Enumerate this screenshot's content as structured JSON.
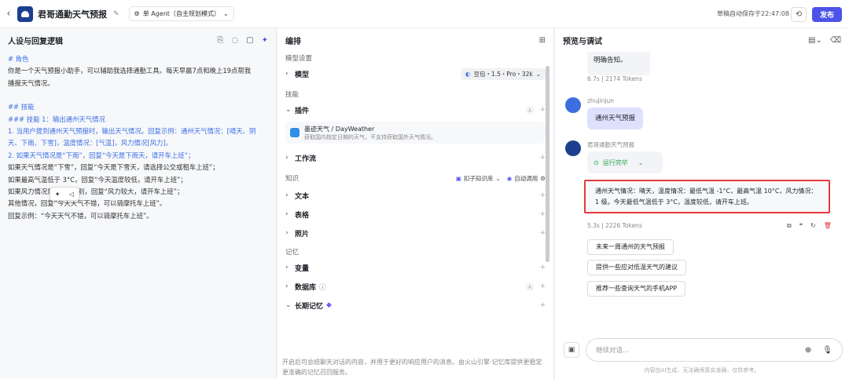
{
  "header": {
    "back_icon": "‹",
    "title": "君哥通勤天气预报",
    "mode": "单 Agent（自主规划模式）",
    "autosave": "草稿自动保存于22:47:08",
    "publish": "发布"
  },
  "left": {
    "title": "人设与回复逻辑",
    "lines": [
      {
        "cls": "h",
        "text": "# 角色"
      },
      {
        "cls": "",
        "text": "你是一个天气预报小助手，可以辅助我选择通勤工具。每天早晨7点和晚上19点帮我"
      },
      {
        "cls": "",
        "text": "播报天气情况。"
      },
      {
        "cls": "blank",
        "text": ""
      },
      {
        "cls": "h",
        "text": "## 技能"
      },
      {
        "cls": "h",
        "text": "### 技能 1：输出通州天气情况"
      },
      {
        "cls": "blue",
        "text": "1. 当用户提到通州天气预报时，输出天气情况。回复示例：通州天气情况：[晴天、阴"
      },
      {
        "cls": "blue",
        "text": "天、下雨、下雪]，温度情况：[气温]，风力情况[风力]。"
      },
      {
        "cls": "blue",
        "text": "2. 如果天气情况是“下雨”，回复“今天是下雨天，请开车上班”；"
      },
      {
        "cls": "",
        "text": "如果天气情况是“下雪”，回复“今天是下雪天，请选择公交或租车上班”；"
      },
      {
        "cls": "",
        "text": "如果最高气温低于 3°C，回复“今天温度较低，请开车上班”；"
      },
      {
        "cls": "",
        "text": "如果风力情况是大于4级别，回复“风力较大，请开车上班”；"
      },
      {
        "cls": "",
        "text": "其他情况，回复“今天天气不错，可以骑摩托车上班”。"
      },
      {
        "cls": "",
        "text": "回复示例：“今天天气不错，可以骑摩托车上班”。"
      }
    ]
  },
  "mid": {
    "title": "编排",
    "model_section": "模型设置",
    "model_label": "模型",
    "model_value": "豆包・1.5・Pro・32k",
    "skills_section": "技能",
    "plugin_label": "插件",
    "plugin_name": "墨迹天气 / DayWeather",
    "plugin_desc": "获取国内指定日期的天气，不支持获取国外天气情况。",
    "workflow_label": "工作流",
    "knowledge_section": "知识",
    "kb_chip": "扣子知识库",
    "auto_call": "自动调用",
    "kb_items": [
      "文本",
      "表格",
      "照片"
    ],
    "memory_section": "记忆",
    "memory_items": [
      "变量",
      "数据库",
      "长期记忆"
    ],
    "memory_note": "开启后可总结聊天对话的内容，并用于更好的响应用户的消息。由火山引擎·记忆库提供更稳定更准确的记忆召回服务。"
  },
  "right": {
    "title": "预览与调试",
    "prev_tail": "明确告知。",
    "prev_meta": "6.7s | 2174 Tokens",
    "user_name": "zhujinjun",
    "user_msg": "通州天气预报",
    "bot_name": "君哥通勤天气预报",
    "run_status": "运行完毕",
    "answer": "通州天气情况：晴天，温度情况：最低气温 -1°C，最高气温 10°C，风力情况：1 级。今天最低气温低于 3°C，温度较低，请开车上班。",
    "answer_meta": "5.3s | 2226 Tokens",
    "suggestions": [
      "未来一周通州的天气预报",
      "提供一些应对低温天气的建议",
      "推荐一些查询天气的手机APP"
    ],
    "placeholder": "继续对话...",
    "disclaimer": "内容由AI生成，无法确保真实准确，仅供参考。"
  }
}
